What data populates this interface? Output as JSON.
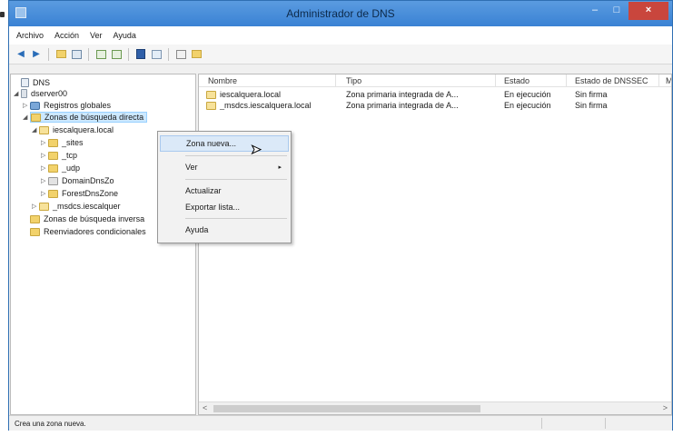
{
  "window": {
    "title": "Administrador de DNS",
    "minimize": "–",
    "maximize": "□",
    "close": "×"
  },
  "menubar": [
    "Archivo",
    "Acción",
    "Ver",
    "Ayuda"
  ],
  "toolbar_icons": [
    "back-arrow-icon",
    "forward-arrow-icon",
    "up-folder-icon",
    "show-hide-tree-icon",
    "refresh-icon",
    "export-list-icon",
    "help-icon",
    "properties-icon",
    "view-icon",
    "folder-icon"
  ],
  "tree": [
    {
      "label": "DNS",
      "icon": "dns-icon"
    },
    {
      "label": "dserver00",
      "icon": "server-icon"
    },
    {
      "label": "Registros globales",
      "icon": "globe-icon"
    },
    {
      "label": "Zonas de búsqueda directa",
      "icon": "folder-icon",
      "selected": true
    },
    {
      "label": "iescalquera.local",
      "icon": "zone-icon"
    },
    {
      "label": "_sites",
      "icon": "folder-icon"
    },
    {
      "label": "_tcp",
      "icon": "folder-icon"
    },
    {
      "label": "_udp",
      "icon": "folder-icon"
    },
    {
      "label": "DomainDnsZo",
      "icon": "zone-gray-icon"
    },
    {
      "label": "ForestDnsZone",
      "icon": "folder-icon"
    },
    {
      "label": "_msdcs.iescalquer",
      "icon": "zone-icon"
    },
    {
      "label": "Zonas de búsqueda inversa",
      "icon": "folder-icon"
    },
    {
      "label": "Reenviadores condicionales",
      "icon": "folder-icon"
    }
  ],
  "list": {
    "columns": [
      "Nombre",
      "Tipo",
      "Estado",
      "Estado de DNSSEC",
      "M"
    ],
    "rows": [
      [
        "iescalquera.local",
        "Zona primaria integrada de A...",
        "En ejecución",
        "Sin firma"
      ],
      [
        "_msdcs.iescalquera.local",
        "Zona primaria integrada de A...",
        "En ejecución",
        "Sin firma"
      ]
    ],
    "scroll_left": "<",
    "scroll_right": ">"
  },
  "context_menu": {
    "items": [
      "Zona nueva...",
      "Ver",
      "Actualizar",
      "Exportar lista...",
      "Ayuda"
    ],
    "submenu_arrow": "▸"
  },
  "status": {
    "text": "Crea una zona nueva."
  },
  "colors": {
    "titlebar": "#3a82d4",
    "close_button": "#c9463d",
    "selection": "#cce8ff"
  }
}
